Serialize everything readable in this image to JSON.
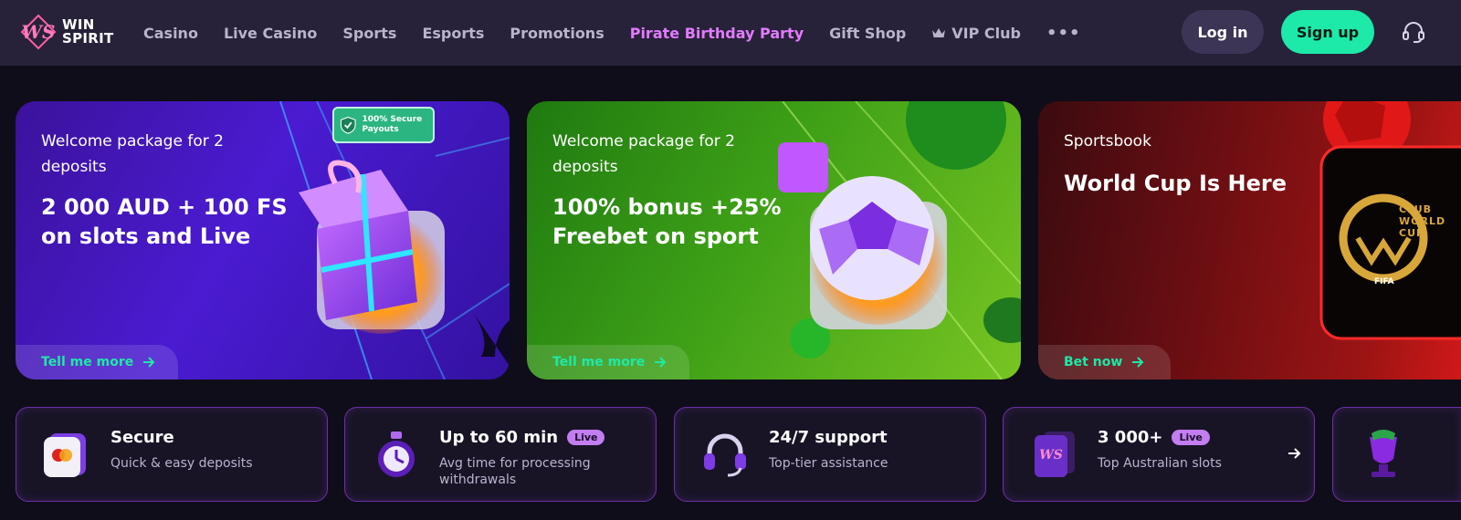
{
  "brand": {
    "logo_line1": "WIN",
    "logo_line2": "SPIRIT"
  },
  "nav": [
    {
      "label": "Casino"
    },
    {
      "label": "Live Casino"
    },
    {
      "label": "Sports"
    },
    {
      "label": "Esports"
    },
    {
      "label": "Promotions"
    },
    {
      "label": "Pirate Birthday Party",
      "highlight": true
    },
    {
      "label": "Gift Shop"
    },
    {
      "label": "VIP Club",
      "icon": "crown-icon"
    }
  ],
  "nav_more": "•••",
  "auth": {
    "login": "Log in",
    "signup": "Sign up"
  },
  "promos": [
    {
      "label": "Welcome package for 2 deposits",
      "title": "2 000 AUD + 100 FS on slots and Live",
      "cta": "Tell me more",
      "badge": "100% Secure Payouts"
    },
    {
      "label": "Welcome package for 2 deposits",
      "title": "100% bonus +25% Freebet on sport",
      "cta": "Tell me more"
    },
    {
      "label": "Sportsbook",
      "title": "World Cup Is Here",
      "cta": "Bet now",
      "art_text": "CLUB WORLD CUP",
      "art_sub": "FIFA"
    }
  ],
  "features": [
    {
      "title": "Secure",
      "desc": "Quick & easy deposits",
      "icon": "card-icon"
    },
    {
      "title": "Up to 60 min",
      "badge": "Live",
      "desc": "Avg time for processing withdrawals",
      "icon": "stopwatch-icon"
    },
    {
      "title": "24/7 support",
      "desc": "Top-tier assistance",
      "icon": "headset-icon"
    },
    {
      "title": "3 000+",
      "badge": "Live",
      "desc": "Top Australian slots",
      "icon": "slots-icon",
      "arrow": true
    },
    {
      "title": "",
      "icon": "trophy-icon"
    }
  ],
  "colors": {
    "accent": "#1de9a8",
    "highlight": "#e27bff",
    "header_bg": "#272239",
    "page_bg": "#0f0d1a"
  }
}
